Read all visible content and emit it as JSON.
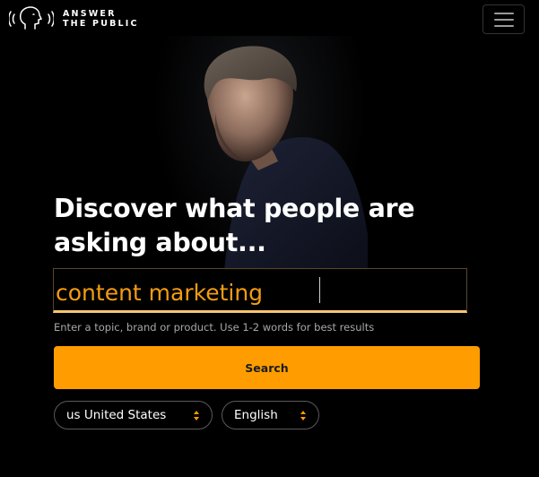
{
  "header": {
    "logo_line1": "ANSWER",
    "logo_line2": "THE PUBLIC",
    "logo_icon": "head-speaking-icon",
    "menu_icon": "hamburger-menu-icon"
  },
  "hero": {
    "headline_line1": "Discover what people are",
    "headline_line2": "asking about...",
    "image": "man-looking-down-photo"
  },
  "search": {
    "value": "content marketing",
    "hint": "Enter a topic, brand or product. Use 1-2 words for best results",
    "button_label": "Search"
  },
  "filters": {
    "country": "us United States",
    "language": "English"
  },
  "colors": {
    "accent": "#ff9d00",
    "input_text": "#f39c12",
    "background": "#000000"
  }
}
